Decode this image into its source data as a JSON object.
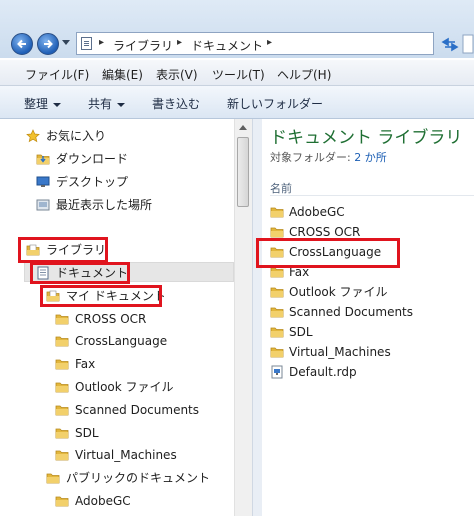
{
  "address_bar": {
    "breadcrumbs": [
      "ライブラリ",
      "ドキュメント"
    ]
  },
  "menubar": {
    "items": [
      "ファイル(F)",
      "編集(E)",
      "表示(V)",
      "ツール(T)",
      "ヘルプ(H)"
    ]
  },
  "toolbar": {
    "organize": "整理",
    "share": "共有",
    "burn": "書き込む",
    "new_folder": "新しいフォルダー"
  },
  "nav_pane": {
    "favorites": "お気に入り",
    "downloads": "ダウンロード",
    "desktop": "デスクトップ",
    "recent": "最近表示した場所",
    "libraries": "ライブラリ",
    "documents": "ドキュメント",
    "my_documents": "マイ ドキュメント",
    "my_doc_folders": [
      "CROSS OCR",
      "CrossLanguage",
      "Fax",
      "Outlook ファイル",
      "Scanned Documents",
      "SDL",
      "Virtual_Machines"
    ],
    "public_documents": "パブリックのドキュメント",
    "public_folders": [
      "AdobeGC"
    ]
  },
  "content": {
    "title": "ドキュメント ライブラリ",
    "subtitle_prefix": "対象フォルダー:",
    "subtitle_link": "2 か所",
    "column_name": "名前",
    "files": [
      {
        "name": "AdobeGC",
        "type": "folder"
      },
      {
        "name": "CROSS OCR",
        "type": "folder"
      },
      {
        "name": "CrossLanguage",
        "type": "folder"
      },
      {
        "name": "Fax",
        "type": "folder"
      },
      {
        "name": "Outlook ファイル",
        "type": "folder"
      },
      {
        "name": "Scanned Documents",
        "type": "folder"
      },
      {
        "name": "SDL",
        "type": "folder"
      },
      {
        "name": "Virtual_Machines",
        "type": "folder"
      },
      {
        "name": "Default.rdp",
        "type": "rdp-file"
      }
    ]
  },
  "colors": {
    "highlight": "#e0141e",
    "folder": "#e8c24a",
    "title_green": "#1f6f33",
    "link_blue": "#1c5fb4"
  }
}
